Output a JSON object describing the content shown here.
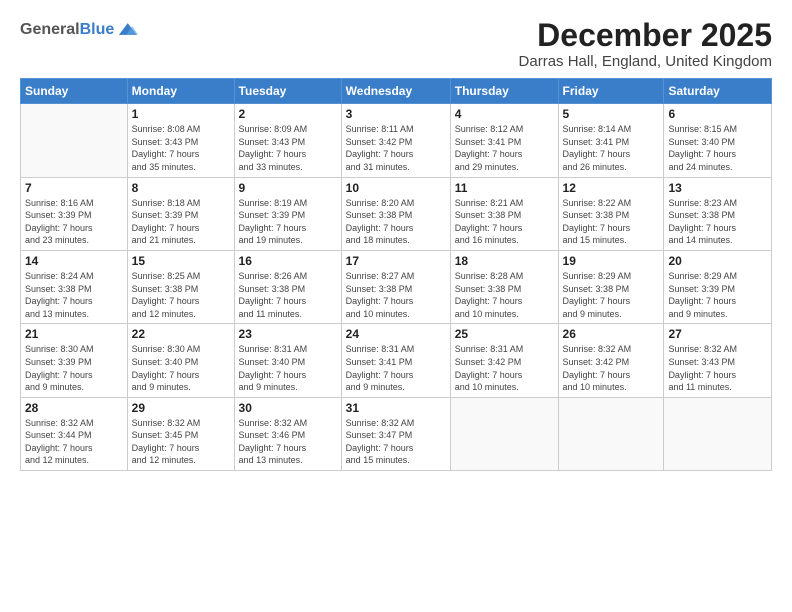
{
  "header": {
    "logo_general": "General",
    "logo_blue": "Blue",
    "month_title": "December 2025",
    "subtitle": "Darras Hall, England, United Kingdom"
  },
  "calendar": {
    "days_of_week": [
      "Sunday",
      "Monday",
      "Tuesday",
      "Wednesday",
      "Thursday",
      "Friday",
      "Saturday"
    ],
    "weeks": [
      [
        {
          "day": "",
          "info": ""
        },
        {
          "day": "1",
          "info": "Sunrise: 8:08 AM\nSunset: 3:43 PM\nDaylight: 7 hours\nand 35 minutes."
        },
        {
          "day": "2",
          "info": "Sunrise: 8:09 AM\nSunset: 3:43 PM\nDaylight: 7 hours\nand 33 minutes."
        },
        {
          "day": "3",
          "info": "Sunrise: 8:11 AM\nSunset: 3:42 PM\nDaylight: 7 hours\nand 31 minutes."
        },
        {
          "day": "4",
          "info": "Sunrise: 8:12 AM\nSunset: 3:41 PM\nDaylight: 7 hours\nand 29 minutes."
        },
        {
          "day": "5",
          "info": "Sunrise: 8:14 AM\nSunset: 3:41 PM\nDaylight: 7 hours\nand 26 minutes."
        },
        {
          "day": "6",
          "info": "Sunrise: 8:15 AM\nSunset: 3:40 PM\nDaylight: 7 hours\nand 24 minutes."
        }
      ],
      [
        {
          "day": "7",
          "info": "Sunrise: 8:16 AM\nSunset: 3:39 PM\nDaylight: 7 hours\nand 23 minutes."
        },
        {
          "day": "8",
          "info": "Sunrise: 8:18 AM\nSunset: 3:39 PM\nDaylight: 7 hours\nand 21 minutes."
        },
        {
          "day": "9",
          "info": "Sunrise: 8:19 AM\nSunset: 3:39 PM\nDaylight: 7 hours\nand 19 minutes."
        },
        {
          "day": "10",
          "info": "Sunrise: 8:20 AM\nSunset: 3:38 PM\nDaylight: 7 hours\nand 18 minutes."
        },
        {
          "day": "11",
          "info": "Sunrise: 8:21 AM\nSunset: 3:38 PM\nDaylight: 7 hours\nand 16 minutes."
        },
        {
          "day": "12",
          "info": "Sunrise: 8:22 AM\nSunset: 3:38 PM\nDaylight: 7 hours\nand 15 minutes."
        },
        {
          "day": "13",
          "info": "Sunrise: 8:23 AM\nSunset: 3:38 PM\nDaylight: 7 hours\nand 14 minutes."
        }
      ],
      [
        {
          "day": "14",
          "info": "Sunrise: 8:24 AM\nSunset: 3:38 PM\nDaylight: 7 hours\nand 13 minutes."
        },
        {
          "day": "15",
          "info": "Sunrise: 8:25 AM\nSunset: 3:38 PM\nDaylight: 7 hours\nand 12 minutes."
        },
        {
          "day": "16",
          "info": "Sunrise: 8:26 AM\nSunset: 3:38 PM\nDaylight: 7 hours\nand 11 minutes."
        },
        {
          "day": "17",
          "info": "Sunrise: 8:27 AM\nSunset: 3:38 PM\nDaylight: 7 hours\nand 10 minutes."
        },
        {
          "day": "18",
          "info": "Sunrise: 8:28 AM\nSunset: 3:38 PM\nDaylight: 7 hours\nand 10 minutes."
        },
        {
          "day": "19",
          "info": "Sunrise: 8:29 AM\nSunset: 3:38 PM\nDaylight: 7 hours\nand 9 minutes."
        },
        {
          "day": "20",
          "info": "Sunrise: 8:29 AM\nSunset: 3:39 PM\nDaylight: 7 hours\nand 9 minutes."
        }
      ],
      [
        {
          "day": "21",
          "info": "Sunrise: 8:30 AM\nSunset: 3:39 PM\nDaylight: 7 hours\nand 9 minutes."
        },
        {
          "day": "22",
          "info": "Sunrise: 8:30 AM\nSunset: 3:40 PM\nDaylight: 7 hours\nand 9 minutes."
        },
        {
          "day": "23",
          "info": "Sunrise: 8:31 AM\nSunset: 3:40 PM\nDaylight: 7 hours\nand 9 minutes."
        },
        {
          "day": "24",
          "info": "Sunrise: 8:31 AM\nSunset: 3:41 PM\nDaylight: 7 hours\nand 9 minutes."
        },
        {
          "day": "25",
          "info": "Sunrise: 8:31 AM\nSunset: 3:42 PM\nDaylight: 7 hours\nand 10 minutes."
        },
        {
          "day": "26",
          "info": "Sunrise: 8:32 AM\nSunset: 3:42 PM\nDaylight: 7 hours\nand 10 minutes."
        },
        {
          "day": "27",
          "info": "Sunrise: 8:32 AM\nSunset: 3:43 PM\nDaylight: 7 hours\nand 11 minutes."
        }
      ],
      [
        {
          "day": "28",
          "info": "Sunrise: 8:32 AM\nSunset: 3:44 PM\nDaylight: 7 hours\nand 12 minutes."
        },
        {
          "day": "29",
          "info": "Sunrise: 8:32 AM\nSunset: 3:45 PM\nDaylight: 7 hours\nand 12 minutes."
        },
        {
          "day": "30",
          "info": "Sunrise: 8:32 AM\nSunset: 3:46 PM\nDaylight: 7 hours\nand 13 minutes."
        },
        {
          "day": "31",
          "info": "Sunrise: 8:32 AM\nSunset: 3:47 PM\nDaylight: 7 hours\nand 15 minutes."
        },
        {
          "day": "",
          "info": ""
        },
        {
          "day": "",
          "info": ""
        },
        {
          "day": "",
          "info": ""
        }
      ]
    ]
  }
}
